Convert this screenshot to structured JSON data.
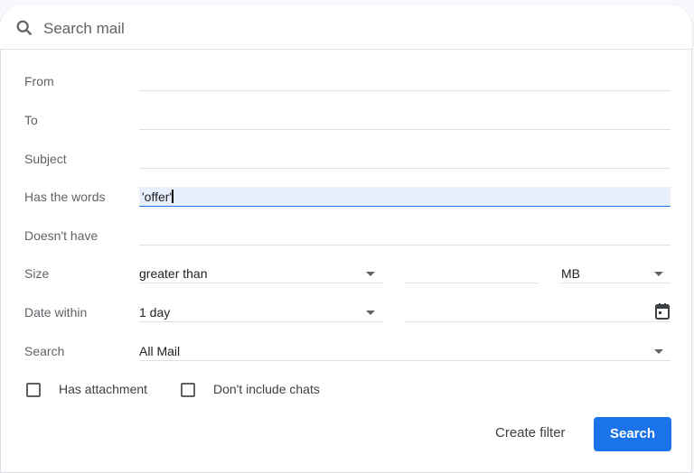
{
  "search": {
    "placeholder": "Search mail"
  },
  "form": {
    "labels": {
      "from": "From",
      "to": "To",
      "subject": "Subject",
      "has_words": "Has the words",
      "doesnt_have": "Doesn't have",
      "size": "Size",
      "date_within": "Date within",
      "search": "Search"
    },
    "values": {
      "from": "",
      "to": "",
      "subject": "",
      "has_words": "'offer'",
      "doesnt_have": "",
      "size_operator": "greater than",
      "size_value": "",
      "size_unit": "MB",
      "date_within": "1 day",
      "date": "",
      "search_in": "All Mail"
    },
    "checkboxes": {
      "has_attachment": "Has attachment",
      "no_chats": "Don't include chats"
    },
    "buttons": {
      "create_filter": "Create filter",
      "search": "Search"
    }
  }
}
